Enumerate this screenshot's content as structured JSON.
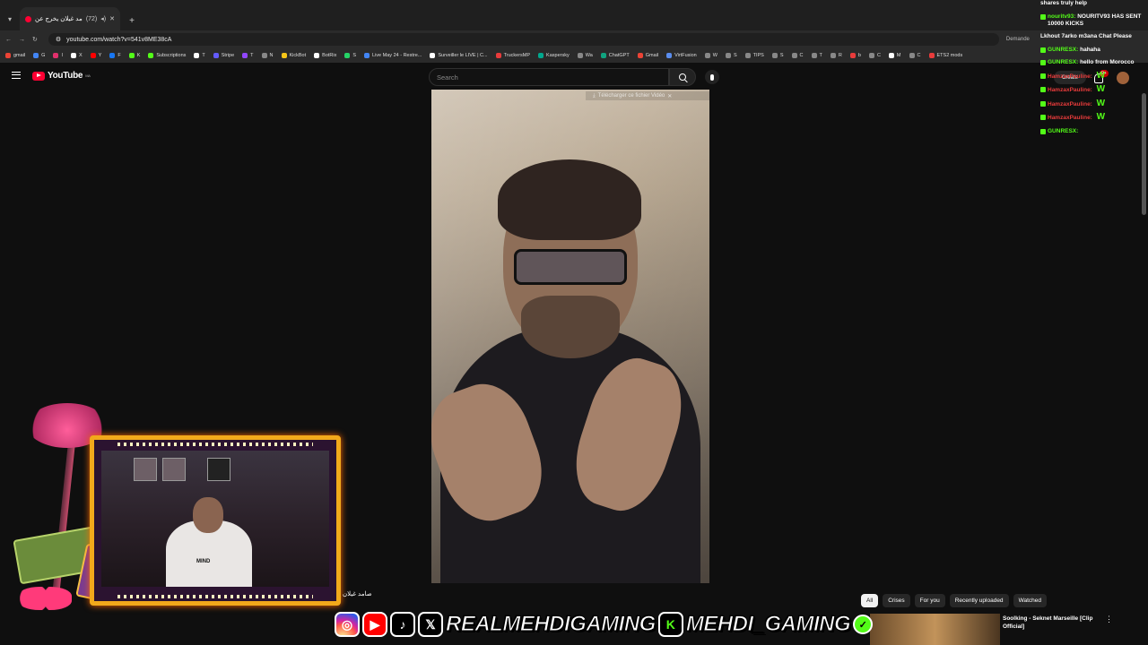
{
  "browser": {
    "tab_title": "صامد غيلان يخرج عن",
    "tab_badge": "(72)",
    "url": "youtube.com/watch?v=541v8ME38cA",
    "bookmarks": [
      "gmail",
      "G",
      "I",
      "X",
      "Y",
      "F",
      "K",
      "Subscriptions",
      "T",
      "Stripe",
      "T",
      "N",
      "KickBot",
      "BotRix",
      "S",
      "Live May 24 - Restre...",
      "Surveiller le LIVE | C...",
      "TruckersMP",
      "Kaspersky",
      "Wa",
      "ChatGPT",
      "Gmail",
      "VirtFusion",
      "W",
      "S",
      "TIPS",
      "S",
      "C",
      "T",
      "R",
      "b",
      "C",
      "M",
      "C",
      "ETS2 mods"
    ],
    "demande": "Demande",
    "favorites": "ous les favoris"
  },
  "youtube": {
    "logo_text": "YouTube",
    "logo_region": "MA",
    "search_placeholder": "Search",
    "create_label": "Create",
    "notification_count": "9+"
  },
  "video": {
    "download_label": "Télécharger ce fichier Vidéo",
    "channel_snippet": "صامد غيلان"
  },
  "chat": [
    {
      "user": "",
      "text": "shares truly help"
    },
    {
      "user": "nouritv93:",
      "text": "NOURITV93 HAS SENT 10000 KICKS",
      "color": "#53fc18"
    },
    {
      "user": "",
      "text": "Lkhout 7arko m3ana Chat Please",
      "color": "#e83b3b"
    },
    {
      "user": "GUNRESX:",
      "text": "hahaha",
      "color": "#53fc18"
    },
    {
      "user": "GUNRESX:",
      "text": "hello from Morocco",
      "color": "#53fc18"
    },
    {
      "user": "HamzaxPauline:",
      "text": "W",
      "color": "#e83b3b"
    },
    {
      "user": "HamzaxPauline:",
      "text": "W",
      "color": "#e83b3b"
    },
    {
      "user": "HamzaxPauline:",
      "text": "W",
      "color": "#e83b3b"
    },
    {
      "user": "HamzaxPauline:",
      "text": "W",
      "color": "#e83b3b"
    },
    {
      "user": "GUNRESX:",
      "text": "",
      "color": "#53fc18"
    }
  ],
  "chips": [
    "All",
    "Crises",
    "For you",
    "Recently uploaded",
    "Watched"
  ],
  "social_banner": {
    "handle_main": "REALMEHDIGAMING",
    "handle_kick": "MEHDI_GAMING"
  },
  "recommendation": {
    "title": "Soolking - Seknet Marseille [Clip Official]"
  },
  "webcam": {
    "shirt_text": "MIND"
  }
}
